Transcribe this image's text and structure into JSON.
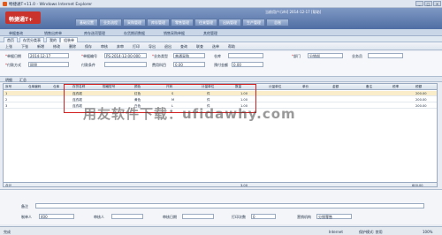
{
  "window": {
    "title": "畅捷通T+11.0 - Windows Internet Explorer",
    "buttons": [
      "_",
      "□",
      "×"
    ]
  },
  "banner": {
    "logo_text": "畅捷通T+",
    "menu": [
      "基础设置",
      "业务流程",
      "采购管理",
      "库存管理",
      "零售管理",
      "往来管理",
      "出纳管理",
      "生产管理",
      "总账"
    ],
    "user_info": "当前用户:[zhl]  2014-12-17  [帮助]"
  },
  "subbar": {
    "items": [
      "单据查询",
      "销售出库单",
      "库存选项管理",
      "存货期初数据",
      "销售采购单据",
      "其他管理"
    ]
  },
  "tabs": [
    "首页",
    "存货分类表",
    "我的",
    "组装单"
  ],
  "toolbar": {
    "items": [
      "上张",
      "下张",
      "新增",
      "修改",
      "删除",
      "保存",
      "审核",
      "弃审",
      "打印",
      "导出",
      "退出",
      "查询",
      "联查",
      "选单",
      "帮助"
    ]
  },
  "form": {
    "date_label": "单据日期",
    "date_value": "2014-12-17",
    "code_label": "单据编号",
    "code_value": "PS-2014-12-00-000",
    "biz_type_label": "业务类型",
    "biz_type_value": "普通采购",
    "warehouse_label": "仓库",
    "warehouse_value": "",
    "dept_label": "部门",
    "dept_value": "分销部",
    "org_label": "业务员",
    "org_value": "",
    "pay_label": "付款方式",
    "pay_value": "网银",
    "invoice_label": "付款条件",
    "invoice_value": "",
    "fee_label": "费用科目",
    "fee_value": "0.00",
    "amount_label": "预付金额",
    "amount_value": "0.00"
  },
  "detail_tabs": [
    "明细",
    "汇总"
  ],
  "grid": {
    "headers": [
      "序号",
      "仓库编码",
      "仓库",
      "存货名称",
      "规格型号",
      "颜色",
      "尺码",
      "计量单位",
      "数量",
      "计量单位",
      "单价",
      "金额",
      "备注",
      "税率",
      "税额"
    ],
    "rows": [
      {
        "num": "1",
        "name": "连衣裙",
        "color": "红色",
        "size": "S",
        "unit": "件",
        "qty": "1.00",
        "price": "200.00"
      },
      {
        "num": "2",
        "name": "连衣裙",
        "color": "黄色",
        "size": "M",
        "unit": "件",
        "qty": "1.00",
        "price": "200.00"
      },
      {
        "num": "3",
        "name": "连衣裙",
        "color": "白色",
        "size": "L",
        "unit": "件",
        "qty": "1.00",
        "price": "200.00"
      }
    ],
    "sum_label": "合计",
    "sum_qty": "3.00",
    "sum_amount": "600.00"
  },
  "watermark": "用友软件下载：ufidawhy.com",
  "footer": {
    "note_label": "备注",
    "maker_label": "制单人",
    "maker_value": "400",
    "auditor_label": "审核人",
    "auditor_value": "",
    "audit_date_label": "审核日期",
    "audit_date_value": "",
    "print_label": "打印次数",
    "print_value": "0",
    "org_label": "营销机构",
    "org_value": "分销零售"
  },
  "statusbar": {
    "left": "完成",
    "zone": "Internet",
    "mode": "保护模式: 禁用",
    "zoom": "100%"
  }
}
